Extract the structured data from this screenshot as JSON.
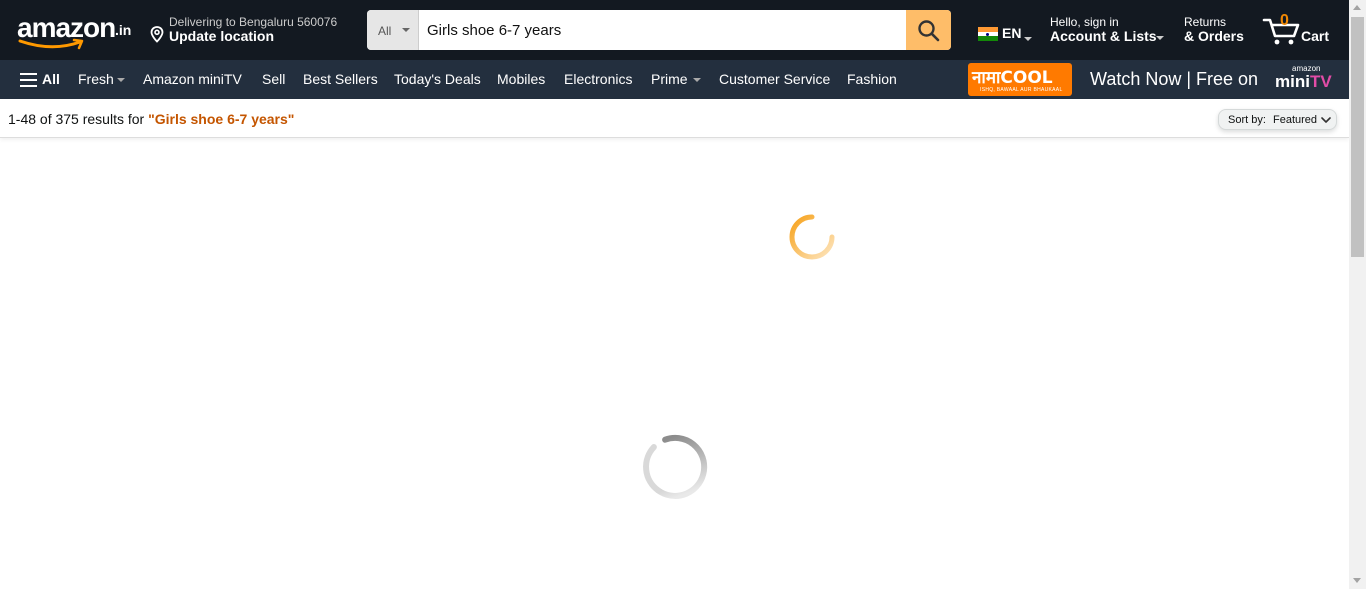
{
  "header": {
    "logo": {
      "word": "amazon",
      "tld": ".in"
    },
    "delivery": {
      "line1": "Delivering to Bengaluru 560076",
      "line2": "Update location",
      "icon": "location-pin-icon"
    },
    "search": {
      "category": "All",
      "value": "Girls shoe 6-7 years",
      "icon": "search-icon"
    },
    "language": {
      "code": "EN",
      "flag_colors": [
        "#ff9933",
        "#ffffff",
        "#138808"
      ]
    },
    "account": {
      "line1": "Hello, sign in",
      "line2": "Account & Lists"
    },
    "returns": {
      "line1": "Returns",
      "line2": "& Orders"
    },
    "cart": {
      "count": "0",
      "label": "Cart",
      "icon": "cart-icon"
    }
  },
  "nav": {
    "all_label": "All",
    "items": [
      "Fresh",
      "Amazon miniTV",
      "Sell",
      "Best Sellers",
      "Today's Deals",
      "Mobiles",
      "Electronics",
      "Prime",
      "Customer Service",
      "Fashion"
    ],
    "promo": {
      "brand_text": "नामाCOOL",
      "brand_tagline": "ISHQ, BAWAAL AUR BHAUKAAL",
      "watch_text": "Watch Now | Free on",
      "mini_small": "amazon",
      "mini_mini": "mini",
      "mini_tv": "TV"
    }
  },
  "results": {
    "count_text": "1-48 of 375 results for ",
    "query": "\"Girls shoe 6-7 years\"",
    "sort_prefix": "Sort by:",
    "sort_value": "Featured"
  },
  "colors": {
    "nav_dark": "#131921",
    "nav_secondary": "#232f3e",
    "search_button": "#febd69",
    "accent_orange": "#f08804",
    "query_color": "#c45500"
  }
}
